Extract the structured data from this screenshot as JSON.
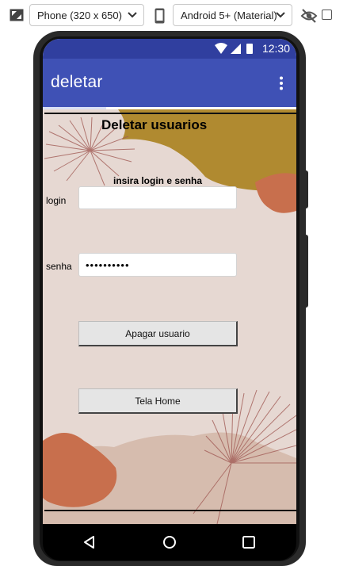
{
  "toolbar": {
    "device_select": "Phone (320 x 650)",
    "platform_select": "Android 5+ (Material)",
    "icons": [
      "resize-icon",
      "phone-device-icon",
      "eye-off-icon",
      "chevron-down-icon"
    ]
  },
  "status_bar": {
    "time": "12:30",
    "icons": [
      "wifi-icon",
      "signal-icon",
      "battery-icon"
    ]
  },
  "app_bar": {
    "title": "deletar",
    "menu_icon": "more-vert-icon"
  },
  "form": {
    "heading": "Deletar usuarios",
    "subheading": "insira login e senha",
    "login_label": "login",
    "login_value": "",
    "senha_label": "senha",
    "senha_value": "••••••••••",
    "delete_button": "Apagar usuario",
    "home_button": "Tela Home"
  },
  "nav_bar": {
    "icons": [
      "back-icon",
      "home-icon",
      "recent-apps-icon"
    ]
  },
  "colors": {
    "status_bar": "#303f9f",
    "app_bar": "#3f51b5",
    "background": "#e6d8d2",
    "mustard": "#b08a30",
    "terracotta": "#c86f4d",
    "beige": "#d6bcae"
  }
}
